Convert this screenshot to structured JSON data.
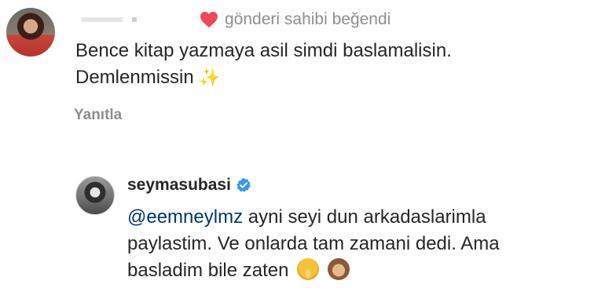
{
  "comment_1": {
    "liked_by_author_text": "gönderi sahibi beğendi",
    "text_line_1": "Bence kitap yazmaya asil simdi baslamalisin.",
    "text_line_2": "Demlenmissin",
    "sparkle": "✨",
    "reply_label": "Yanıtla"
  },
  "comment_2": {
    "username": "seymasubasi",
    "mention": "@eemneylmz",
    "text_line_1_rest": " ayni seyi dun arkadaslarimla",
    "text_line_2": "paylastim. Ve onlarda tam zamani dedi. Ama",
    "text_line_3": "basladim bile zaten"
  },
  "colors": {
    "heart": "#ed4956",
    "verified": "#3897f0",
    "mention": "#00376b",
    "meta_text": "#8e8e8e"
  },
  "icons": {
    "heart": "heart-icon",
    "verified": "verified-badge-icon",
    "shush_emoji": "shushing-face-emoji",
    "monkey_emoji": "see-no-evil-monkey-emoji"
  }
}
